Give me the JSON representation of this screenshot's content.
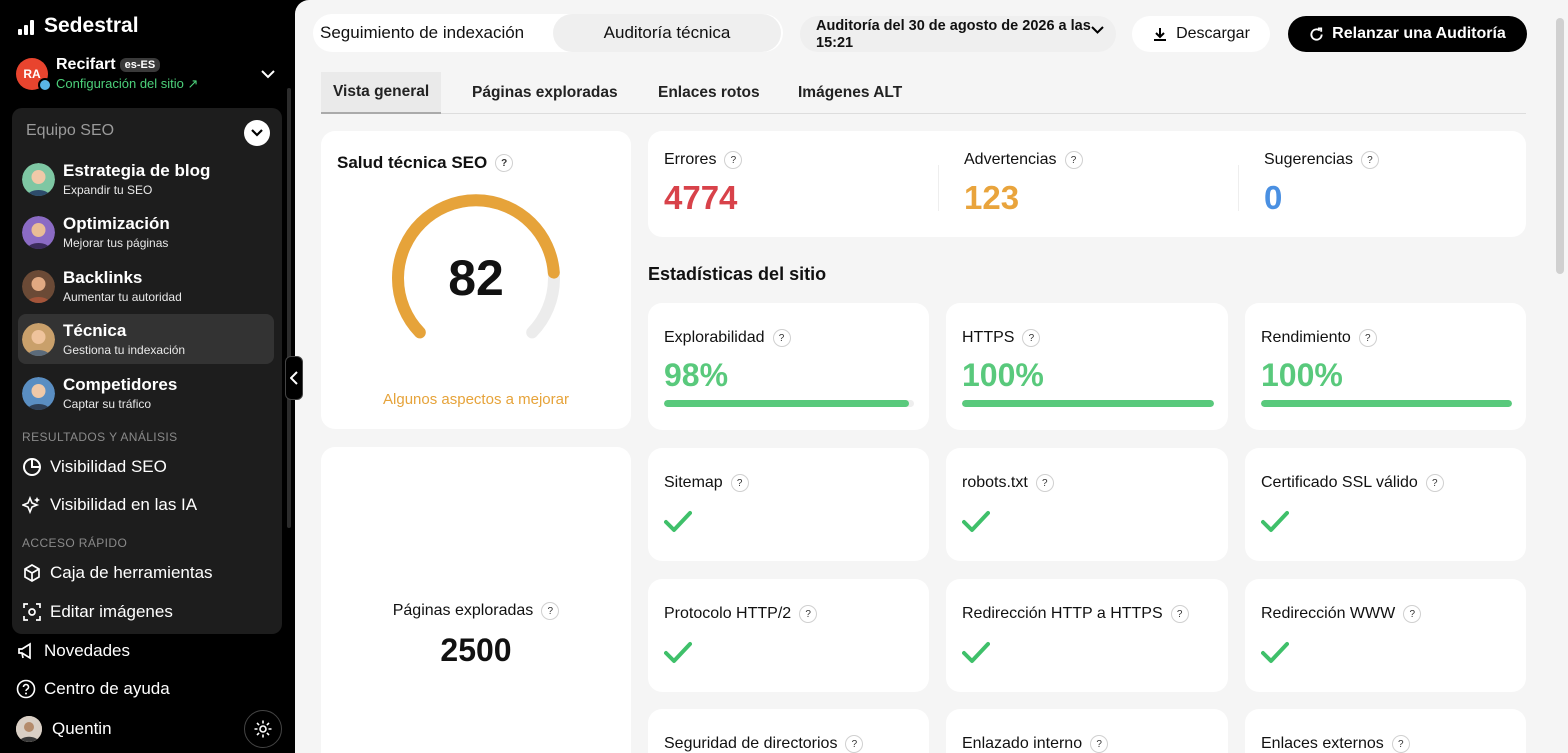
{
  "sidebar": {
    "brand": "Sedestral",
    "site": {
      "avatar_text": "RA",
      "name": "Recifart",
      "locale": "es-ES",
      "config_link": "Configuración del sitio ↗"
    },
    "team": {
      "title": "Equipo SEO",
      "agents": [
        {
          "title": "Estrategia de blog",
          "subtitle": "Expandir tu SEO"
        },
        {
          "title": "Optimización",
          "subtitle": "Mejorar tus páginas"
        },
        {
          "title": "Backlinks",
          "subtitle": "Aumentar tu autoridad"
        },
        {
          "title": "Técnica",
          "subtitle": "Gestiona tu indexación"
        },
        {
          "title": "Competidores",
          "subtitle": "Captar su tráfico"
        }
      ],
      "results_section": "RESULTADOS Y ANÁLISIS",
      "results": [
        "Visibilidad SEO",
        "Visibilidad en las IA"
      ],
      "quick_section": "ACCESO RÁPIDO",
      "quick": [
        "Caja de herramientas",
        "Editar imágenes"
      ]
    },
    "news": "Novedades",
    "help": "Centro de ayuda",
    "user": "Quentin"
  },
  "header": {
    "segment_a": "Seguimiento de indexación",
    "segment_b": "Auditoría técnica",
    "audit_select": "Auditoría del 30 de agosto de 2026 a las 15:21",
    "download": "Descargar",
    "rerun": "Relanzar una Auditoría"
  },
  "tabs": [
    "Vista general",
    "Páginas exploradas",
    "Enlaces rotos",
    "Imágenes ALT"
  ],
  "health": {
    "title": "Salud técnica SEO",
    "score": "82",
    "score_fraction": 0.82,
    "status": "Algunos aspectos a mejorar"
  },
  "issues": [
    {
      "label": "Errores",
      "value": "4774",
      "color": "#d8424a"
    },
    {
      "label": "Advertencias",
      "value": "123",
      "color": "#e9a43c"
    },
    {
      "label": "Sugerencias",
      "value": "0",
      "color": "#4a90e2"
    }
  ],
  "stats_title": "Estadísticas del sitio",
  "metrics": [
    {
      "label": "Explorabilidad",
      "value": "98%",
      "fraction": 0.98
    },
    {
      "label": "HTTPS",
      "value": "100%",
      "fraction": 1.0
    },
    {
      "label": "Rendimiento",
      "value": "100%",
      "fraction": 1.0
    }
  ],
  "checks": [
    "Sitemap",
    "robots.txt",
    "Certificado SSL válido",
    "Protocolo HTTP/2",
    "Redirección HTTP a HTTPS",
    "Redirección WWW",
    "Seguridad de directorios",
    "Enlazado interno",
    "Enlaces externos"
  ],
  "pages": {
    "label": "Páginas exploradas",
    "value": "2500"
  },
  "colors": {
    "accent_green": "#59c97c",
    "gauge": "#e6a33a",
    "link_green": "#4cd07a"
  }
}
